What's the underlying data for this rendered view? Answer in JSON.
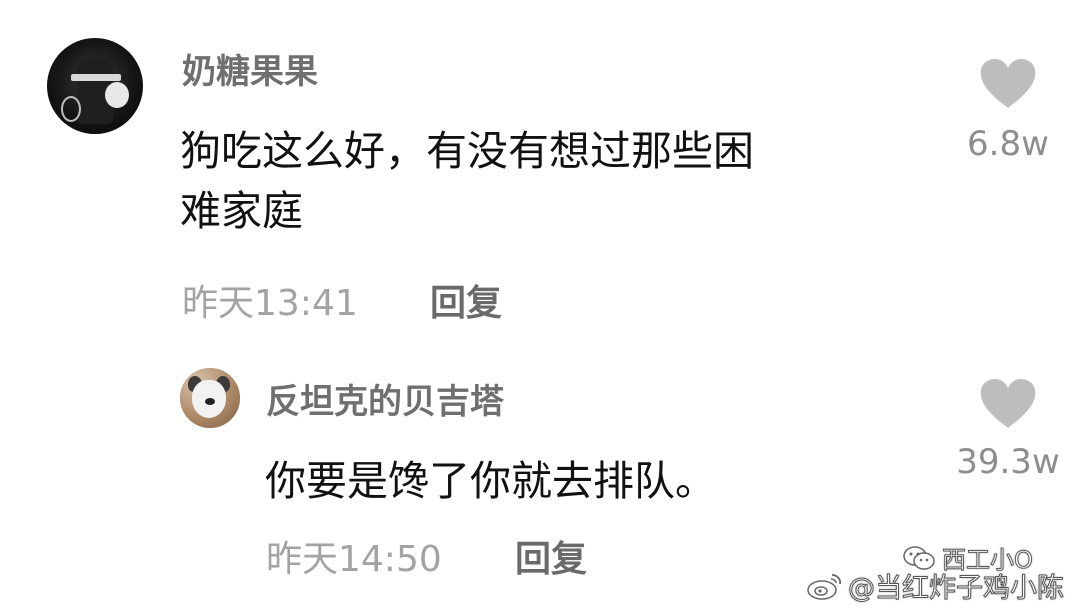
{
  "comment": {
    "username": "奶糖果果",
    "content_line1": "狗吃这么好，有没有想过那些困",
    "content_line2": "难家庭",
    "time": "昨天13:41",
    "reply_label": "回复",
    "likes": "6.8w"
  },
  "reply": {
    "username": "反坦克的贝吉塔",
    "content": "你要是馋了你就去排队。",
    "time": "昨天14:50",
    "reply_label": "回复",
    "likes": "39.3w"
  },
  "watermark": {
    "wechat_text": "西工小O",
    "weibo_text": "@当红炸子鸡小陈"
  },
  "colors": {
    "username": "#6f6f6f",
    "content": "#111111",
    "time": "#a3a3a3",
    "reply": "#6a6a6a",
    "heart": "#bdbdbd",
    "like_count": "#8d8d8d"
  },
  "icons": {
    "like": "heart-icon",
    "wechat": "wechat-icon",
    "weibo": "weibo-icon"
  }
}
